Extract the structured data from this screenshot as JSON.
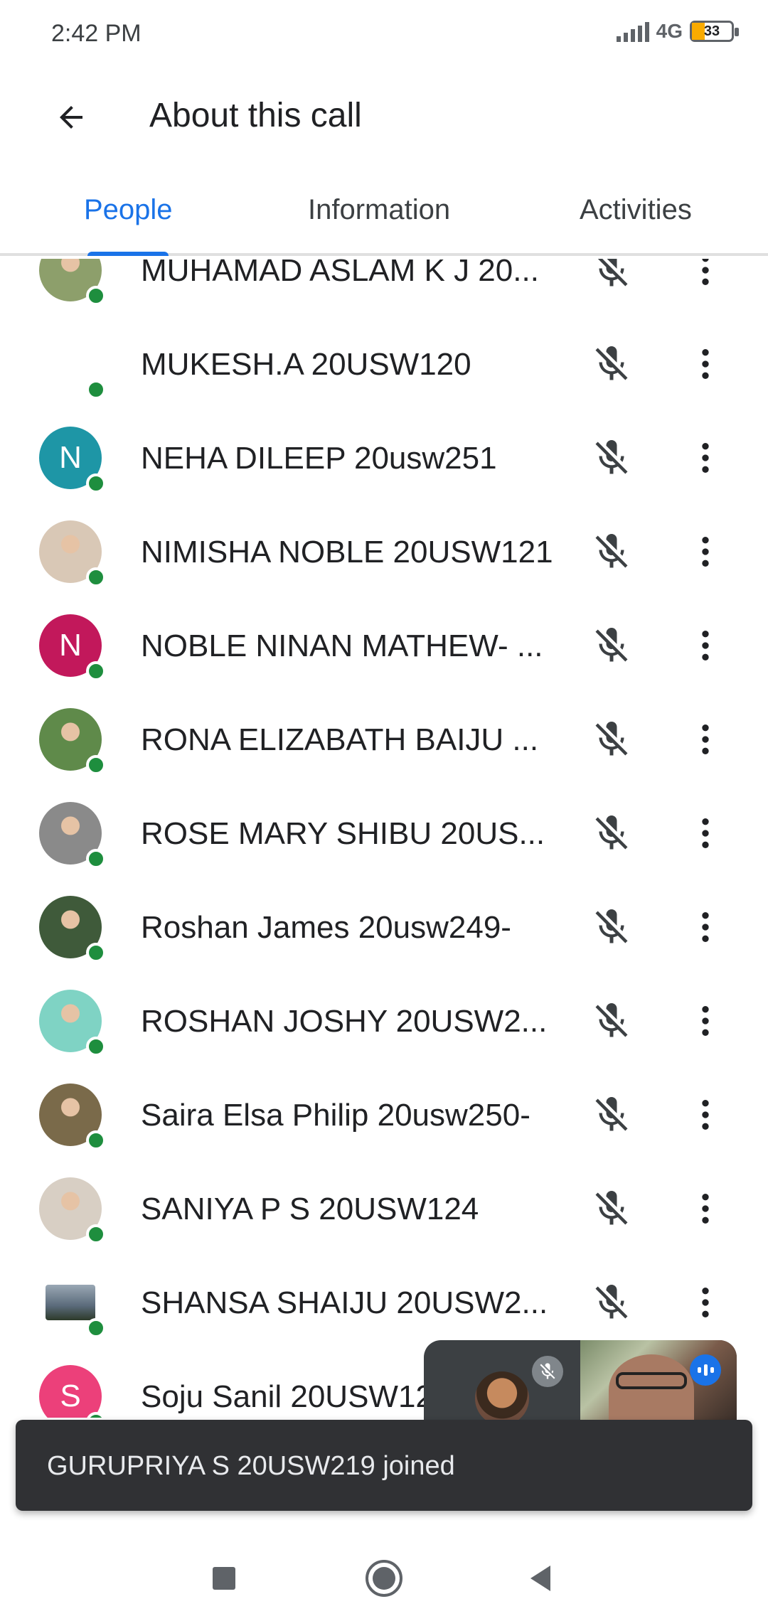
{
  "status_bar": {
    "time": "2:42 PM",
    "network": "4G",
    "battery": "33",
    "battery_level": 0.33
  },
  "app_bar": {
    "title": "About this call",
    "back_icon": "arrow-back-icon"
  },
  "tabs": [
    {
      "label": "People",
      "active": true
    },
    {
      "label": "Information",
      "active": false
    },
    {
      "label": "Activities",
      "active": false
    }
  ],
  "participants": [
    {
      "name": "MUHAMAD ASLAM K J 20...",
      "avatar_type": "photo",
      "avatar_color": "#8d9f6b",
      "online": true,
      "muted": true
    },
    {
      "name": "MUKESH.A 20USW120",
      "avatar_type": "none",
      "avatar_color": "#ffffff",
      "online": true,
      "muted": true
    },
    {
      "name": "NEHA DILEEP 20usw251",
      "avatar_type": "letter",
      "letter": "N",
      "avatar_color": "#1e96a6",
      "online": true,
      "muted": true
    },
    {
      "name": "NIMISHA NOBLE 20USW121",
      "avatar_type": "photo",
      "avatar_color": "#d9c8b6",
      "online": true,
      "muted": true
    },
    {
      "name": "NOBLE NINAN MATHEW- ...",
      "avatar_type": "letter",
      "letter": "N",
      "avatar_color": "#c2185b",
      "online": true,
      "muted": true
    },
    {
      "name": "RONA ELIZABATH BAIJU ...",
      "avatar_type": "photo",
      "avatar_color": "#5f8a4a",
      "online": true,
      "muted": true
    },
    {
      "name": "ROSE MARY SHIBU 20US...",
      "avatar_type": "photo",
      "avatar_color": "#8a8a8a",
      "online": true,
      "muted": true
    },
    {
      "name": "Roshan James 20usw249-",
      "avatar_type": "photo",
      "avatar_color": "#3f5a3a",
      "online": true,
      "muted": true
    },
    {
      "name": "ROSHAN JOSHY 20USW2...",
      "avatar_type": "photo",
      "avatar_color": "#7fd3c4",
      "online": true,
      "muted": true
    },
    {
      "name": "Saira Elsa Philip 20usw250-",
      "avatar_type": "photo",
      "avatar_color": "#7a6a4a",
      "online": true,
      "muted": true
    },
    {
      "name": "SANIYA P S 20USW124",
      "avatar_type": "photo",
      "avatar_color": "#d8cfc4",
      "online": true,
      "muted": true
    },
    {
      "name": "SHANSA SHAIJU 20USW2...",
      "avatar_type": "square",
      "avatar_color": "#5a6a7a",
      "online": true,
      "muted": true
    },
    {
      "name": "Soju Sanil 20USW12",
      "avatar_type": "letter",
      "letter": "S",
      "avatar_color": "#ec407a",
      "online": true,
      "muted": true
    }
  ],
  "snackbar": {
    "text": "GURUPRIYA S 20USW219 joined"
  },
  "colors": {
    "accent": "#1a73e8",
    "online": "#1e8e3e",
    "snackbar_bg": "#303134"
  }
}
